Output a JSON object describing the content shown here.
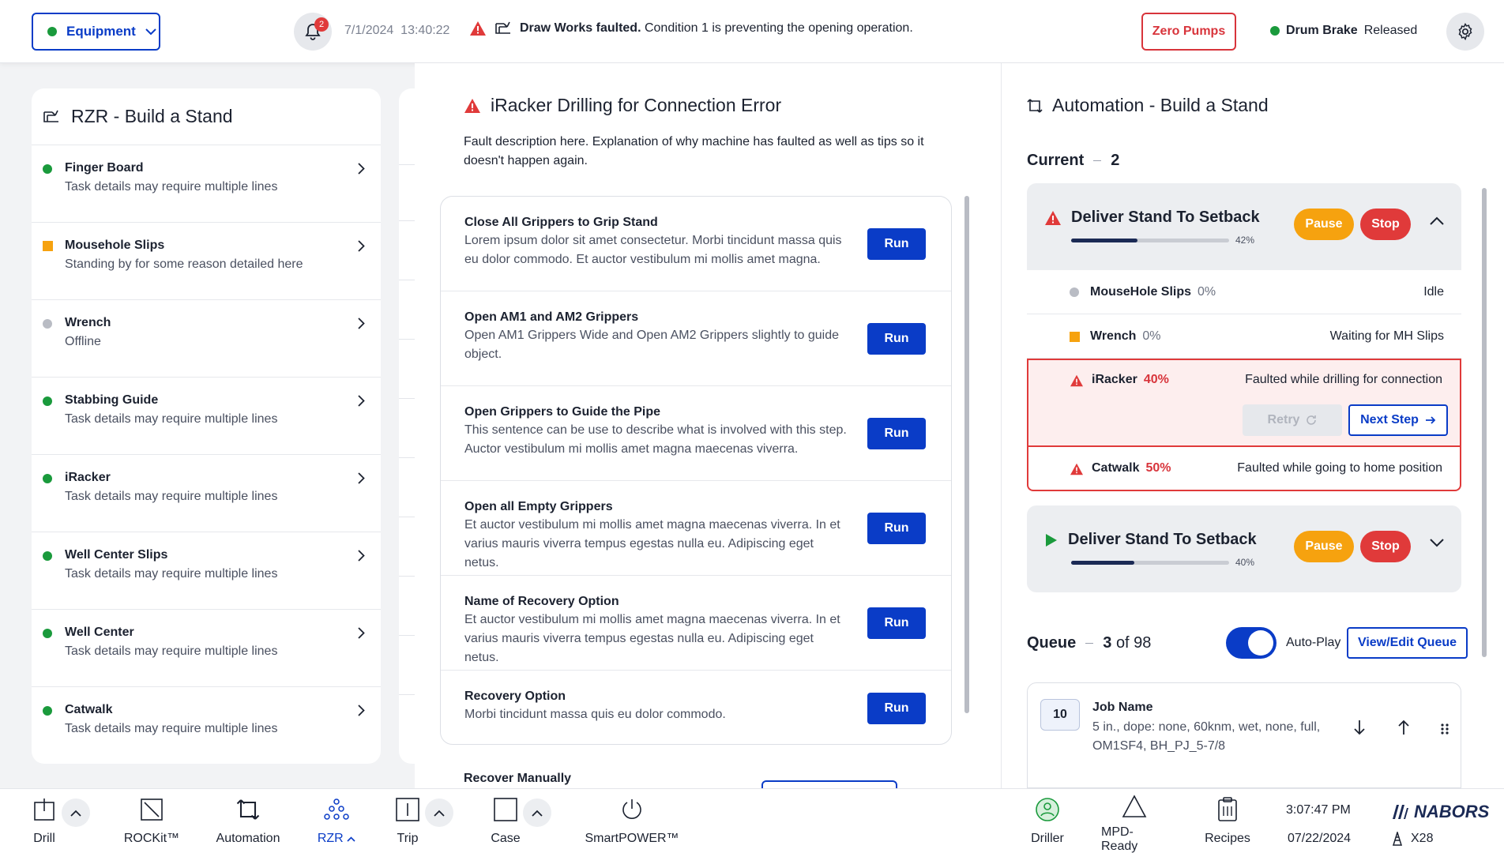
{
  "topbar": {
    "equipment_label": "Equipment",
    "notification_count": "2",
    "date": "7/1/2024",
    "time": "13:40:22",
    "fault_title": "Draw Works faulted.",
    "fault_detail": "Condition 1 is preventing the opening operation.",
    "zero_pumps": "Zero Pumps",
    "drum_brake_label": "Drum Brake",
    "drum_brake_state": "Released"
  },
  "left": {
    "title": "RZR - Build a Stand",
    "items": [
      {
        "name": "Finger Board",
        "detail": "Task details may require multiple lines",
        "status": "green"
      },
      {
        "name": "Mousehole Slips",
        "detail": "Standing by for some reason detailed here",
        "status": "orange"
      },
      {
        "name": "Wrench",
        "detail": "Offline",
        "status": "gray"
      },
      {
        "name": "Stabbing Guide",
        "detail": "Task details may require multiple lines",
        "status": "green"
      },
      {
        "name": "iRacker",
        "detail": "Task details may require multiple lines",
        "status": "green"
      },
      {
        "name": "Well Center Slips",
        "detail": "Task details may require multiple lines",
        "status": "green"
      },
      {
        "name": "Well Center",
        "detail": "Task details may require multiple lines",
        "status": "green"
      },
      {
        "name": "Catwalk",
        "detail": "Task details may require multiple lines",
        "status": "green"
      }
    ]
  },
  "middle": {
    "title": "iRacker Drilling for Connection Error",
    "description": "Fault description here. Explanation of why machine has faulted as well as tips so it doesn't happen again.",
    "run_label": "Run",
    "steps": [
      {
        "name": "Close All Grippers to Grip Stand",
        "desc": "Lorem ipsum dolor sit amet consectetur. Morbi tincidunt massa quis eu dolor commodo. Et auctor vestibulum mi mollis amet magna."
      },
      {
        "name": "Open AM1 and AM2 Grippers",
        "desc": "Open AM1 Grippers Wide and Open AM2 Grippers slightly to guide object."
      },
      {
        "name": "Open Grippers to Guide the Pipe",
        "desc": "This sentence can be use to describe what is involved with this step. Auctor vestibulum mi mollis amet magna maecenas viverra."
      },
      {
        "name": "Open all Empty Grippers",
        "desc": "Et auctor vestibulum mi mollis amet magna maecenas viverra. In et varius mauris viverra tempus egestas nulla eu. Adipiscing eget netus."
      },
      {
        "name": "Name of Recovery Option",
        "desc": "Et auctor vestibulum mi mollis amet magna maecenas viverra. In et varius mauris viverra tempus egestas nulla eu. Adipiscing eget netus."
      },
      {
        "name": "Recovery Option",
        "desc": "Morbi tincidunt massa quis eu dolor commodo."
      }
    ],
    "recover_manually": "Recover Manually"
  },
  "right": {
    "title": "Automation - Build a Stand",
    "current_label": "Current",
    "current_count": "2",
    "card1": {
      "title": "Deliver Stand To Setback",
      "progress": 42,
      "progress_label": "42%",
      "pause": "Pause",
      "stop": "Stop",
      "rows": [
        {
          "name": "MouseHole Slips",
          "pct": "0%",
          "status": "Idle"
        },
        {
          "name": "Wrench",
          "pct": "0%",
          "status": "Waiting for MH Slips"
        },
        {
          "name": "iRacker",
          "pct": "40%",
          "status": "Faulted while drilling for connection"
        },
        {
          "name": "Catwalk",
          "pct": "50%",
          "status": "Faulted while going to home position"
        }
      ],
      "retry": "Retry",
      "next_step": "Next Step"
    },
    "card2": {
      "title": "Deliver Stand To Setback",
      "progress": 40,
      "progress_label": "40%",
      "pause": "Pause",
      "stop": "Stop"
    },
    "queue_label": "Queue",
    "queue_current": "3",
    "queue_of": "of 98",
    "autoplay": "Auto-Play",
    "autoplay_on": true,
    "view_edit": "View/Edit Queue",
    "job": {
      "number": "10",
      "name": "Job Name",
      "desc": "5 in., dope: none, 60knm, wet, none, full, OM1SF4,  BH_PJ_5-7/8"
    }
  },
  "bottom": {
    "nav": [
      "Drill",
      "ROCKit™",
      "Automation",
      "RZR",
      "Trip",
      "Case",
      "SmartPOWER™"
    ],
    "right_nav": [
      "Driller",
      "MPD-Ready",
      "Recipes"
    ],
    "clock": "3:07:47 PM",
    "date": "07/22/2024",
    "brand": "NABORS",
    "rig": "X28"
  },
  "colors": {
    "primary": "#0a3cc7",
    "danger": "#e03a3a",
    "warning": "#f6a20f",
    "ok": "#1a9a3c"
  }
}
